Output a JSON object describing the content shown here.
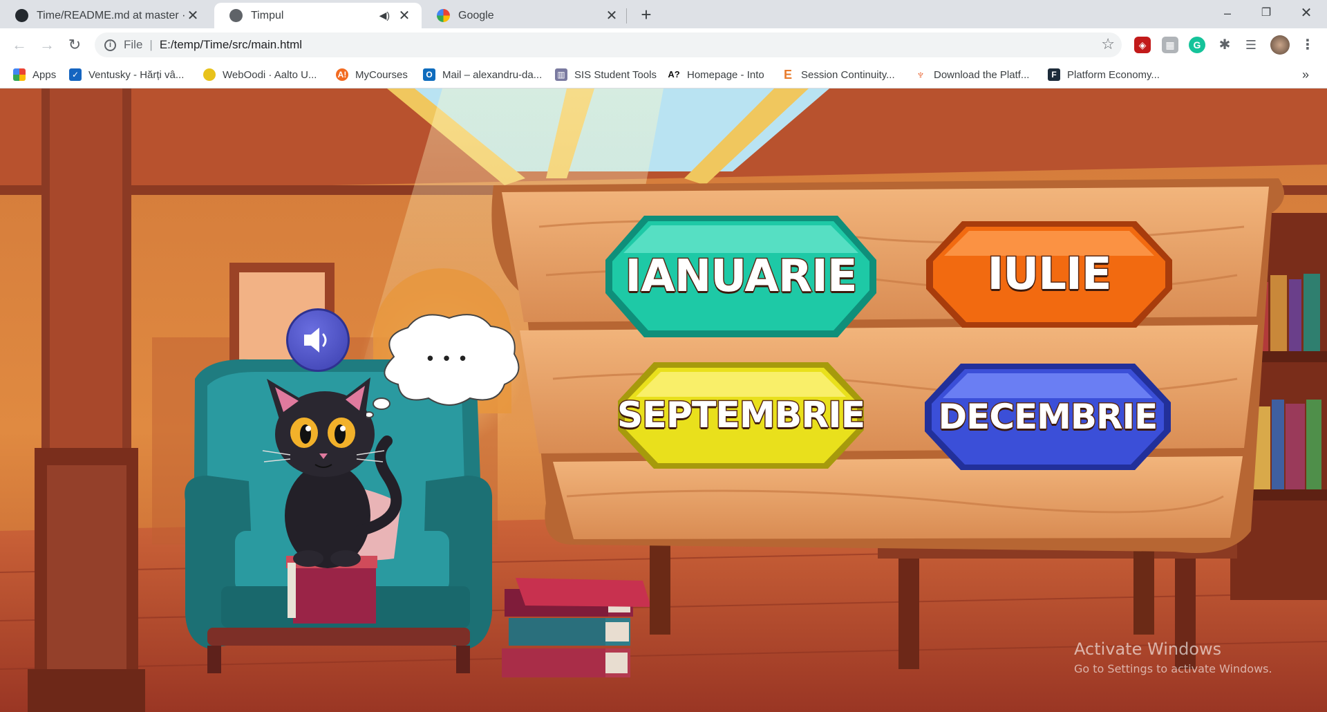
{
  "browser": {
    "tabs": [
      {
        "title": "Time/README.md at master · da",
        "icon": "github-icon"
      },
      {
        "title": "Timpul",
        "icon": "globe-icon",
        "active": true,
        "muted_icon": "speaker-icon"
      },
      {
        "title": "Google",
        "icon": "google-icon"
      }
    ],
    "address": {
      "protocol": "File",
      "url": "E:/temp/Time/src/main.html"
    },
    "bookmarks": [
      {
        "label": "Apps",
        "icon": "apps-grid-icon",
        "color": "#ea4335"
      },
      {
        "label": "Ventusky - Hărți vâ...",
        "icon": "ventusky-icon",
        "color": "#1565c0"
      },
      {
        "label": "WebOodi · Aalto U...",
        "icon": "weboodi-icon",
        "color": "#e8c21b"
      },
      {
        "label": "MyCourses",
        "icon": "mycourses-icon",
        "color": "#f26b21"
      },
      {
        "label": "Mail – alexandru-da...",
        "icon": "outlook-icon",
        "color": "#0f6cbd"
      },
      {
        "label": "SIS Student Tools",
        "icon": "sis-icon",
        "color": "#7a7aa0"
      },
      {
        "label": "Homepage - Into",
        "icon": "into-icon",
        "color": "#111111"
      },
      {
        "label": "Session Continuity...",
        "icon": "session-icon",
        "color": "#e87b2c"
      },
      {
        "label": "Download the Platf...",
        "icon": "download-icon",
        "color": "#e8602c"
      },
      {
        "label": "Platform Economy...",
        "icon": "platform-icon",
        "color": "#1d2b3a"
      }
    ]
  },
  "game": {
    "speaker_icon": "speaker-icon",
    "thought": "• • •",
    "months": [
      {
        "label": "IANUARIE",
        "color": "#1ec9a6"
      },
      {
        "label": "IULIE",
        "color": "#f26a10"
      },
      {
        "label": "SEPTEMBRIE",
        "color": "#e9e01c"
      },
      {
        "label": "DECEMBRIE",
        "color": "#3b4fd8"
      }
    ]
  },
  "os": {
    "activate_title": "Activate Windows",
    "activate_sub": "Go to Settings to activate Windows."
  }
}
